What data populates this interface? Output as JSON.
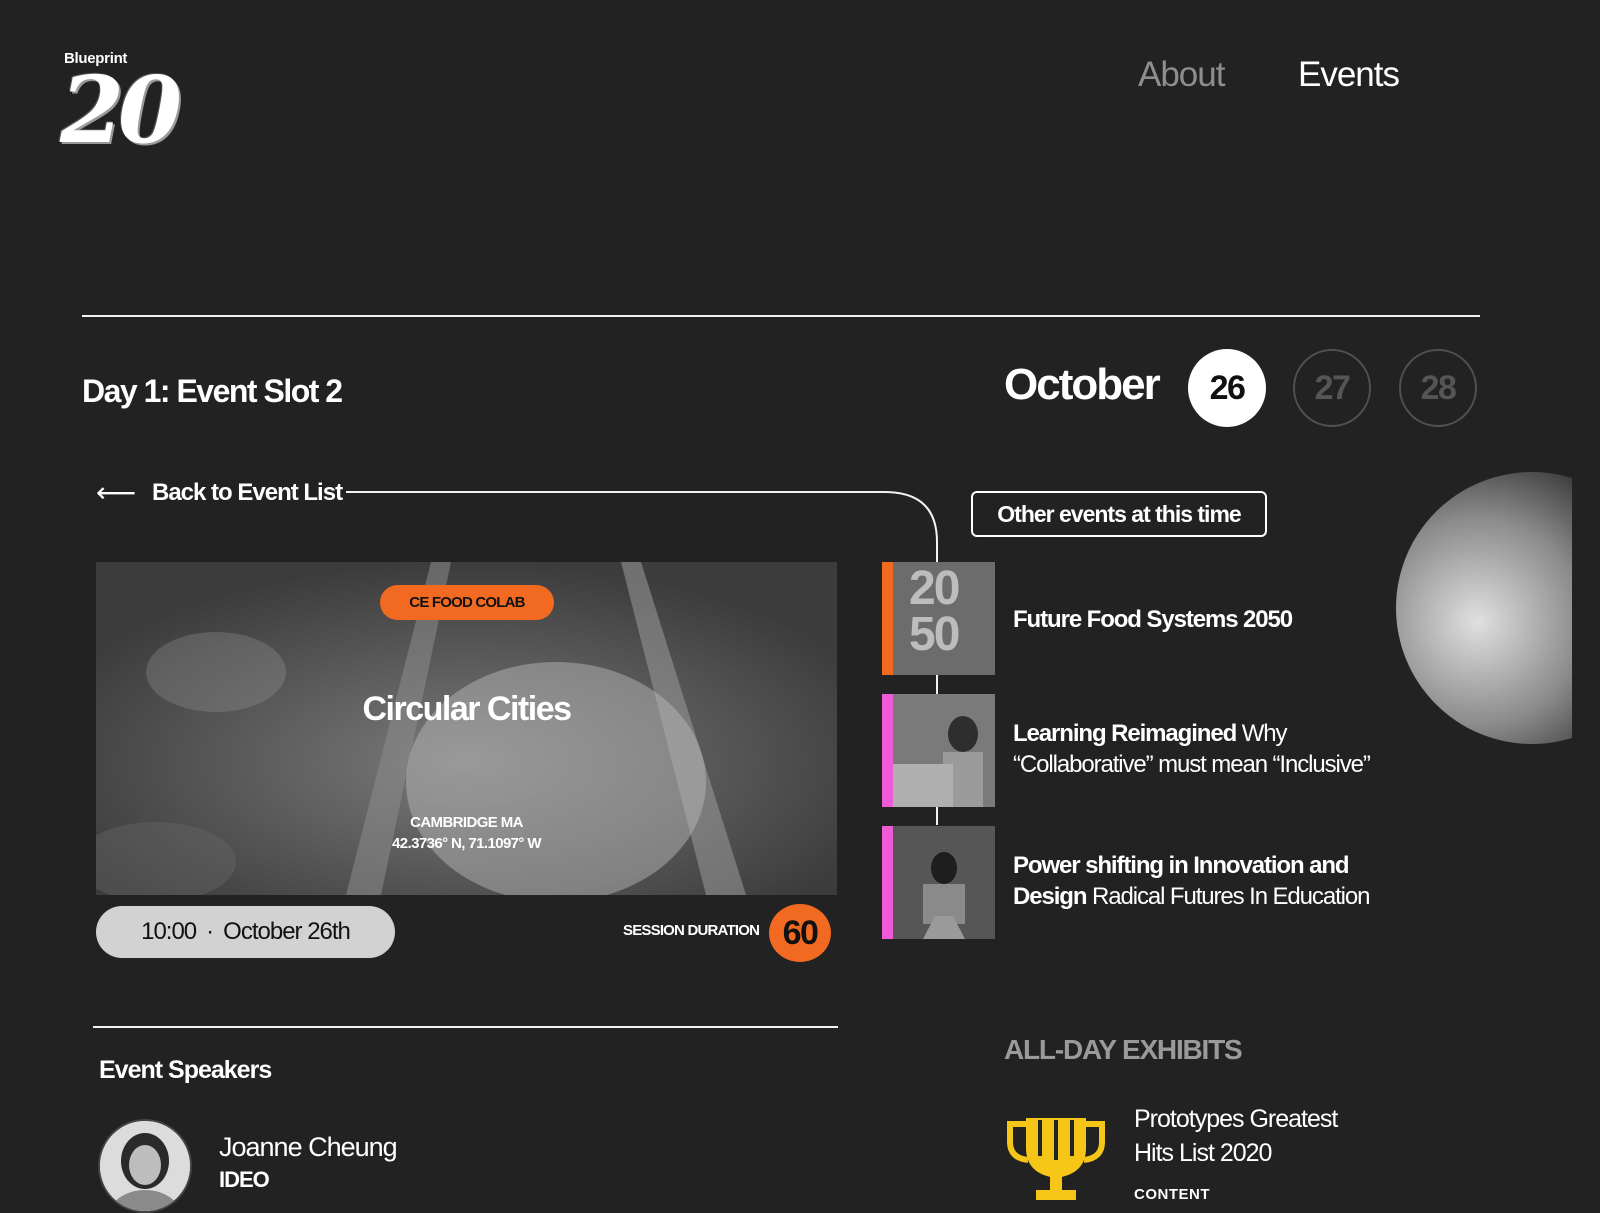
{
  "logo": {
    "small": "Blueprint",
    "big": "20"
  },
  "nav": {
    "about": "About",
    "events": "Events"
  },
  "page_title": "Day 1: Event Slot 2",
  "calendar": {
    "month": "October",
    "days": [
      {
        "label": "26",
        "active": true
      },
      {
        "label": "27",
        "active": false
      },
      {
        "label": "28",
        "active": false
      }
    ]
  },
  "back_link": {
    "arrow": "⟵",
    "label": "Back to Event List"
  },
  "other_events_label": "Other events at this time",
  "hero": {
    "tag": "CE FOOD COLAB",
    "title": "Circular Cities",
    "location": "CAMBRIDGE MA",
    "coordinates": "42.3736° N, 71.1097° W"
  },
  "session": {
    "time": "10:00",
    "separator": "·",
    "date": "October 26th",
    "duration_label": "SESSION DURATION",
    "duration_value": "60"
  },
  "speakers": {
    "heading": "Event Speakers",
    "items": [
      {
        "name": "Joanne Cheung",
        "org": "IDEO"
      }
    ]
  },
  "other_events": [
    {
      "bold": "Future Food Systems 2050",
      "rest": "",
      "accent": "#f26a21",
      "thumb_text_top": "20",
      "thumb_text_bottom": "50"
    },
    {
      "bold": "Learning Reimagined",
      "rest": " Why “Collaborative” must mean “Inclusive”",
      "accent": "#ef5bd6"
    },
    {
      "bold": "Power shifting in Innovation and Design",
      "rest": " Radical Futures In Education",
      "accent": "#ef5bd6"
    }
  ],
  "exhibits": {
    "heading": "ALL-DAY EXHIBITS",
    "title": "Prototypes Greatest Hits List 2020",
    "sub": "CONTENT",
    "icon": "trophy-icon",
    "icon_color": "#f5c518"
  },
  "colors": {
    "background": "#222223",
    "accent_orange": "#f26a21",
    "accent_pink": "#ef5bd6"
  }
}
